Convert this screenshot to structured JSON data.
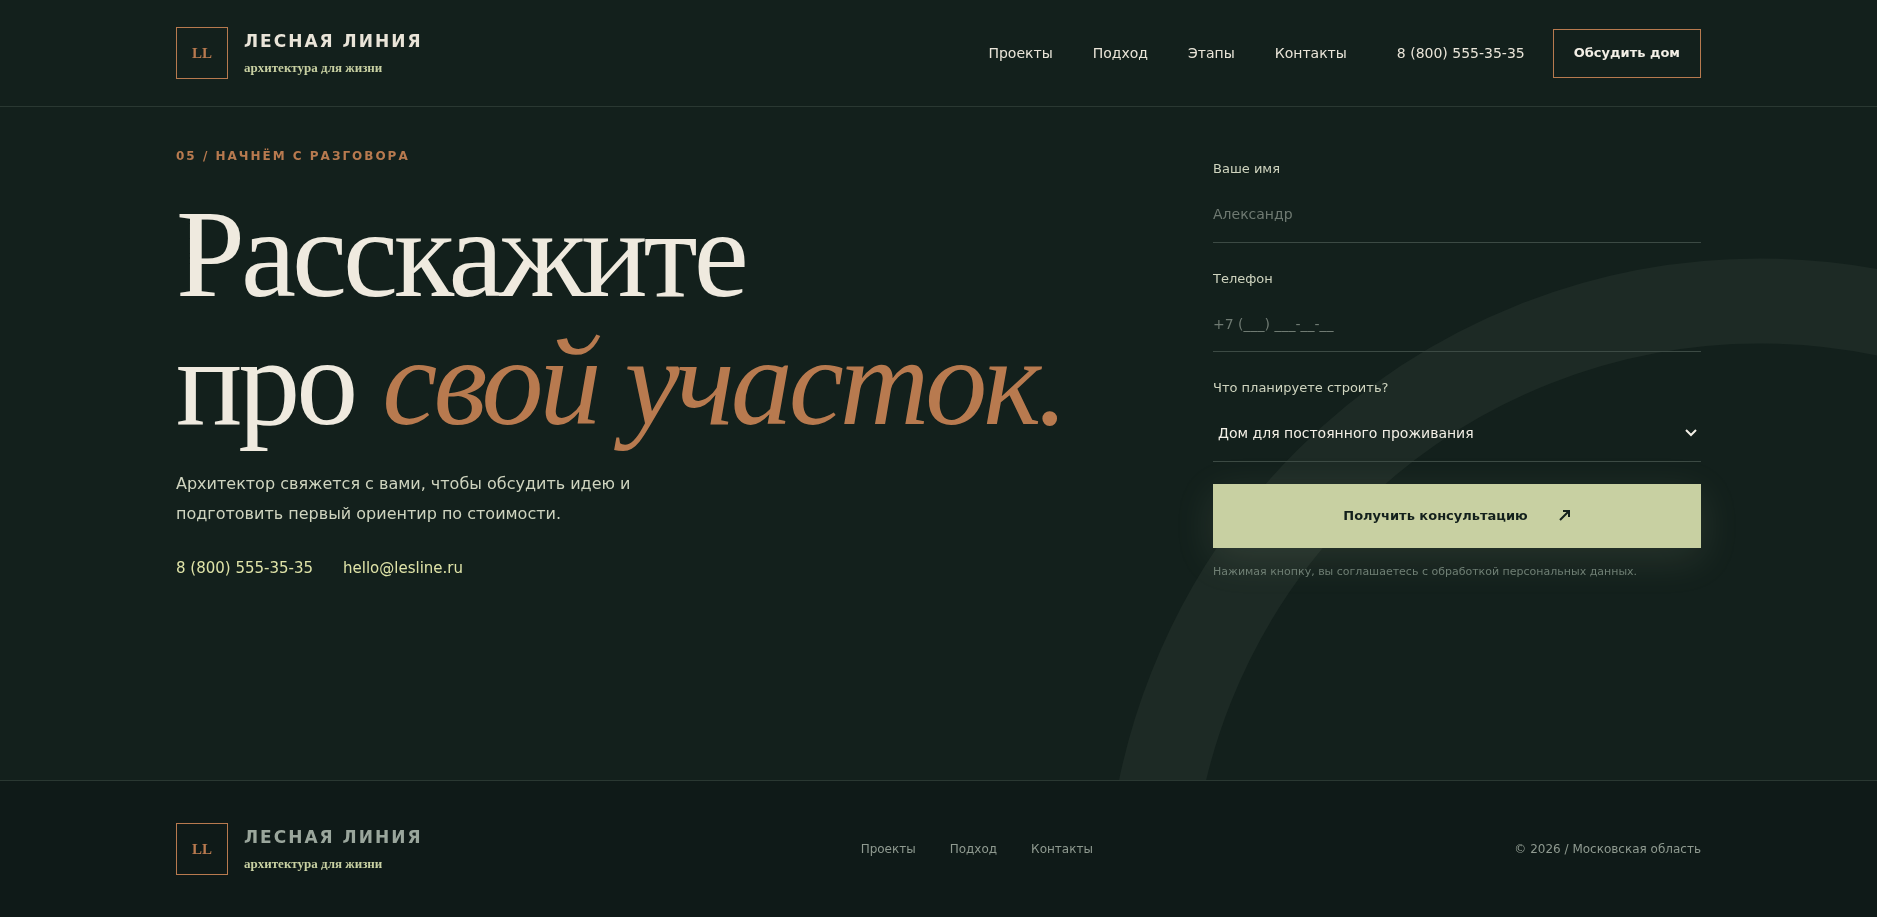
{
  "header": {
    "logo": {
      "mark": "LL",
      "name": "ЛЕСНАЯ ЛИНИЯ",
      "tagline": "архитектура для жизни"
    },
    "nav": [
      "Проекты",
      "Подход",
      "Этапы",
      "Контакты"
    ],
    "phone": "8 (800) 555-35-35",
    "cta": "Обсудить дом"
  },
  "hero": {
    "eyebrow": "05 / НАЧНЁМ С РАЗГОВОРА",
    "title_line_1": "Расскажите",
    "title_line_2_plain": "про",
    "title_line_2_accent": "свой участок.",
    "lead": "Архитектор свяжется с вами, чтобы обсудить идею и подготовить первый ориентир по стоимости.",
    "contacts": [
      "8 (800) 555-35-35",
      "hello@lesline.ru"
    ]
  },
  "form": {
    "fields": [
      {
        "kind": "text",
        "label": "Ваше имя",
        "placeholder": "Александр"
      },
      {
        "kind": "text",
        "label": "Телефон",
        "placeholder": "+7 (___) ___-__-__"
      },
      {
        "kind": "select",
        "label": "Что планируете строить?",
        "value": "Дом для постоянного проживания"
      }
    ],
    "submit": "Получить консультацию",
    "consent": "Нажимая кнопку, вы соглашаетесь с обработкой персональных данных."
  },
  "footer": {
    "logo": {
      "mark": "LL",
      "name": "ЛЕСНАЯ ЛИНИЯ",
      "tagline": "архитектура для жизни"
    },
    "nav": [
      "Проекты",
      "Подход",
      "Контакты"
    ],
    "copyright": "© 2026 / Московская область"
  }
}
